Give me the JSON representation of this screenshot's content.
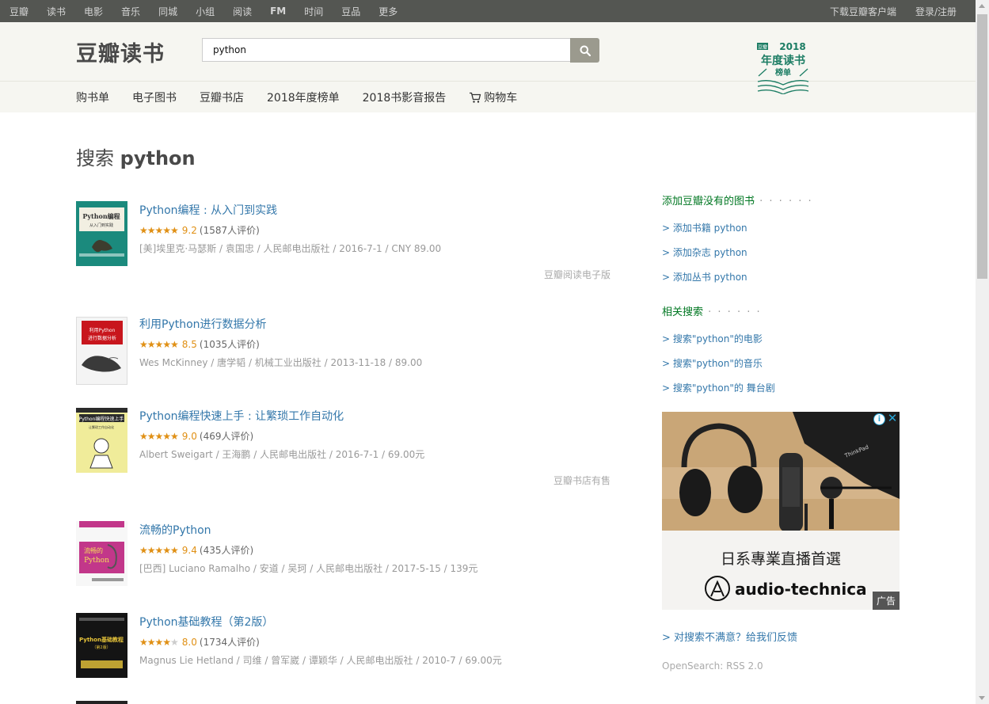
{
  "topnav": {
    "items": [
      "豆瓣",
      "读书",
      "电影",
      "音乐",
      "同城",
      "小组",
      "阅读",
      "FM",
      "时间",
      "豆品",
      "更多"
    ],
    "download": "下载豆瓣客户端",
    "login": "登录/注册"
  },
  "header": {
    "logo": "豆瓣读书",
    "search_value": "python",
    "subnav": [
      "购书单",
      "电子图书",
      "豆瓣书店",
      "2018年度榜单",
      "2018书影音报告",
      "购物车"
    ],
    "banner": {
      "tag": "豆瓣",
      "year": "2018",
      "line1": "年度读书",
      "line2": "榜单"
    }
  },
  "page": {
    "title_prefix": "搜索",
    "title_query": "python"
  },
  "books": [
    {
      "title": "Python编程 : 从入门到实践",
      "stars": 4.5,
      "score": "9.2",
      "votes": "(1587人评价)",
      "meta": "[美]埃里克·马瑟斯 / 袁国忠 / 人民邮电出版社 / 2016-7-1 / CNY 89.00",
      "avail": "豆瓣阅读电子版",
      "cover_color": "#1b8a7d"
    },
    {
      "title": "利用Python进行数据分析",
      "stars": 4.5,
      "score": "8.5",
      "votes": "(1035人评价)",
      "meta": "Wes McKinney / 唐学韬 / 机械工业出版社 / 2013-11-18 / 89.00",
      "avail": "",
      "cover_color": "#f2f2f2"
    },
    {
      "title": "Python编程快速上手 : 让繁琐工作自动化",
      "stars": 4.5,
      "score": "9.0",
      "votes": "(469人评价)",
      "meta": "Albert Sweigart / 王海鹏 / 人民邮电出版社 / 2016-7-1 / 69.00元",
      "avail": "豆瓣书店有售",
      "cover_color": "#e8e27a"
    },
    {
      "title": "流畅的Python",
      "stars": 4.5,
      "score": "9.4",
      "votes": "(435人评价)",
      "meta": "[巴西] Luciano Ramalho / 安道 / 吴珂 / 人民邮电出版社 / 2017-5-15 / 139元",
      "avail": "",
      "cover_color": "#f4f4f4"
    },
    {
      "title": "Python基础教程（第2版）",
      "stars": 4,
      "score": "8.0",
      "votes": "(1734人评价)",
      "meta": "Magnus Lie Hetland / 司维 / 曾军崴 / 谭颖华 / 人民邮电出版社 / 2010-7 / 69.00元",
      "avail": "",
      "cover_color": "#151515"
    }
  ],
  "sidebar": {
    "add_title": "添加豆瓣没有的图书",
    "add_links": [
      "> 添加书籍 python",
      "> 添加杂志 python",
      "> 添加丛书 python"
    ],
    "related_title": "相关搜索",
    "related_links": [
      "> 搜索\"python\"的电影",
      "> 搜索\"python\"的音乐",
      "> 搜索\"python\"的 舞台剧"
    ],
    "ad_text": "日系專業直播首選",
    "ad_brand": "audio-technica",
    "ad_label": "广告",
    "ad_laptop_brand": "ThinkPad",
    "feedback": "> 对搜索不满意？给我们反馈",
    "opensearch": "OpenSearch: RSS 2.0"
  },
  "colors": {
    "topbar": "#545652",
    "header_bg": "#f6f6f1",
    "link": "#3377aa",
    "green": "#007722",
    "star": "#e09015"
  }
}
